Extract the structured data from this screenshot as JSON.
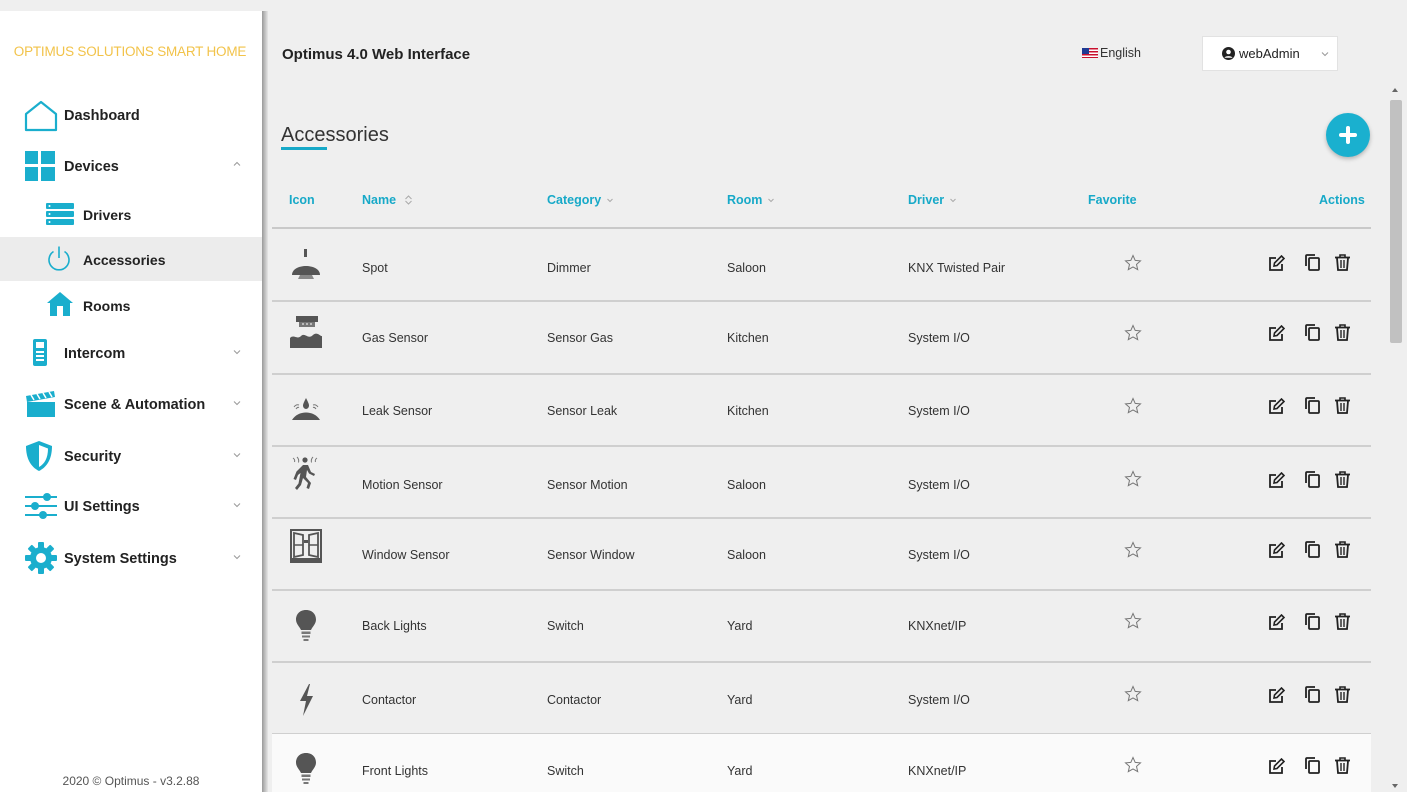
{
  "sidebar": {
    "brand": "OPTIMUS SOLUTIONS SMART HOME",
    "items": [
      {
        "label": "Dashboard",
        "icon": "house-outline-icon"
      },
      {
        "label": "Devices",
        "icon": "grid-icon",
        "expanded": true
      },
      {
        "label": "Drivers",
        "icon": "server-rack-icon"
      },
      {
        "label": "Accessories",
        "icon": "power-icon",
        "active": true
      },
      {
        "label": "Rooms",
        "icon": "house-icon"
      },
      {
        "label": "Intercom",
        "icon": "intercom-icon"
      },
      {
        "label": "Scene & Automation",
        "icon": "clapperboard-icon"
      },
      {
        "label": "Security",
        "icon": "shield-icon"
      },
      {
        "label": "UI Settings",
        "icon": "sliders-icon"
      },
      {
        "label": "System Settings",
        "icon": "gear-icon"
      }
    ],
    "footer": "2020 © Optimus - v3.2.88"
  },
  "header": {
    "title": "Optimus 4.0 Web Interface",
    "language": "English",
    "user": "webAdmin"
  },
  "page": {
    "title": "Accessories"
  },
  "table": {
    "headers": {
      "icon": "Icon",
      "name": "Name",
      "category": "Category",
      "room": "Room",
      "driver": "Driver",
      "favorite": "Favorite",
      "actions": "Actions"
    },
    "rows": [
      {
        "icon": "spot-lamp-icon",
        "name": "Spot",
        "category": "Dimmer",
        "room": "Saloon",
        "driver": "KNX Twisted Pair"
      },
      {
        "icon": "gas-sensor-icon",
        "name": "Gas Sensor",
        "category": "Sensor Gas",
        "room": "Kitchen",
        "driver": "System I/O"
      },
      {
        "icon": "leak-sensor-icon",
        "name": "Leak Sensor",
        "category": "Sensor Leak",
        "room": "Kitchen",
        "driver": "System I/O"
      },
      {
        "icon": "motion-sensor-icon",
        "name": "Motion Sensor",
        "category": "Sensor Motion",
        "room": "Saloon",
        "driver": "System I/O"
      },
      {
        "icon": "window-sensor-icon",
        "name": "Window Sensor",
        "category": "Sensor Window",
        "room": "Saloon",
        "driver": "System I/O"
      },
      {
        "icon": "light-bulb-icon",
        "name": "Back Lights",
        "category": "Switch",
        "room": "Yard",
        "driver": "KNXnet/IP"
      },
      {
        "icon": "lightning-bolt-icon",
        "name": "Contactor",
        "category": "Contactor",
        "room": "Yard",
        "driver": "System I/O"
      },
      {
        "icon": "light-bulb-icon",
        "name": "Front Lights",
        "category": "Switch",
        "room": "Yard",
        "driver": "KNXnet/IP"
      }
    ]
  },
  "colors": {
    "accent": "#17a9c8",
    "brand": "#f2c34a"
  }
}
